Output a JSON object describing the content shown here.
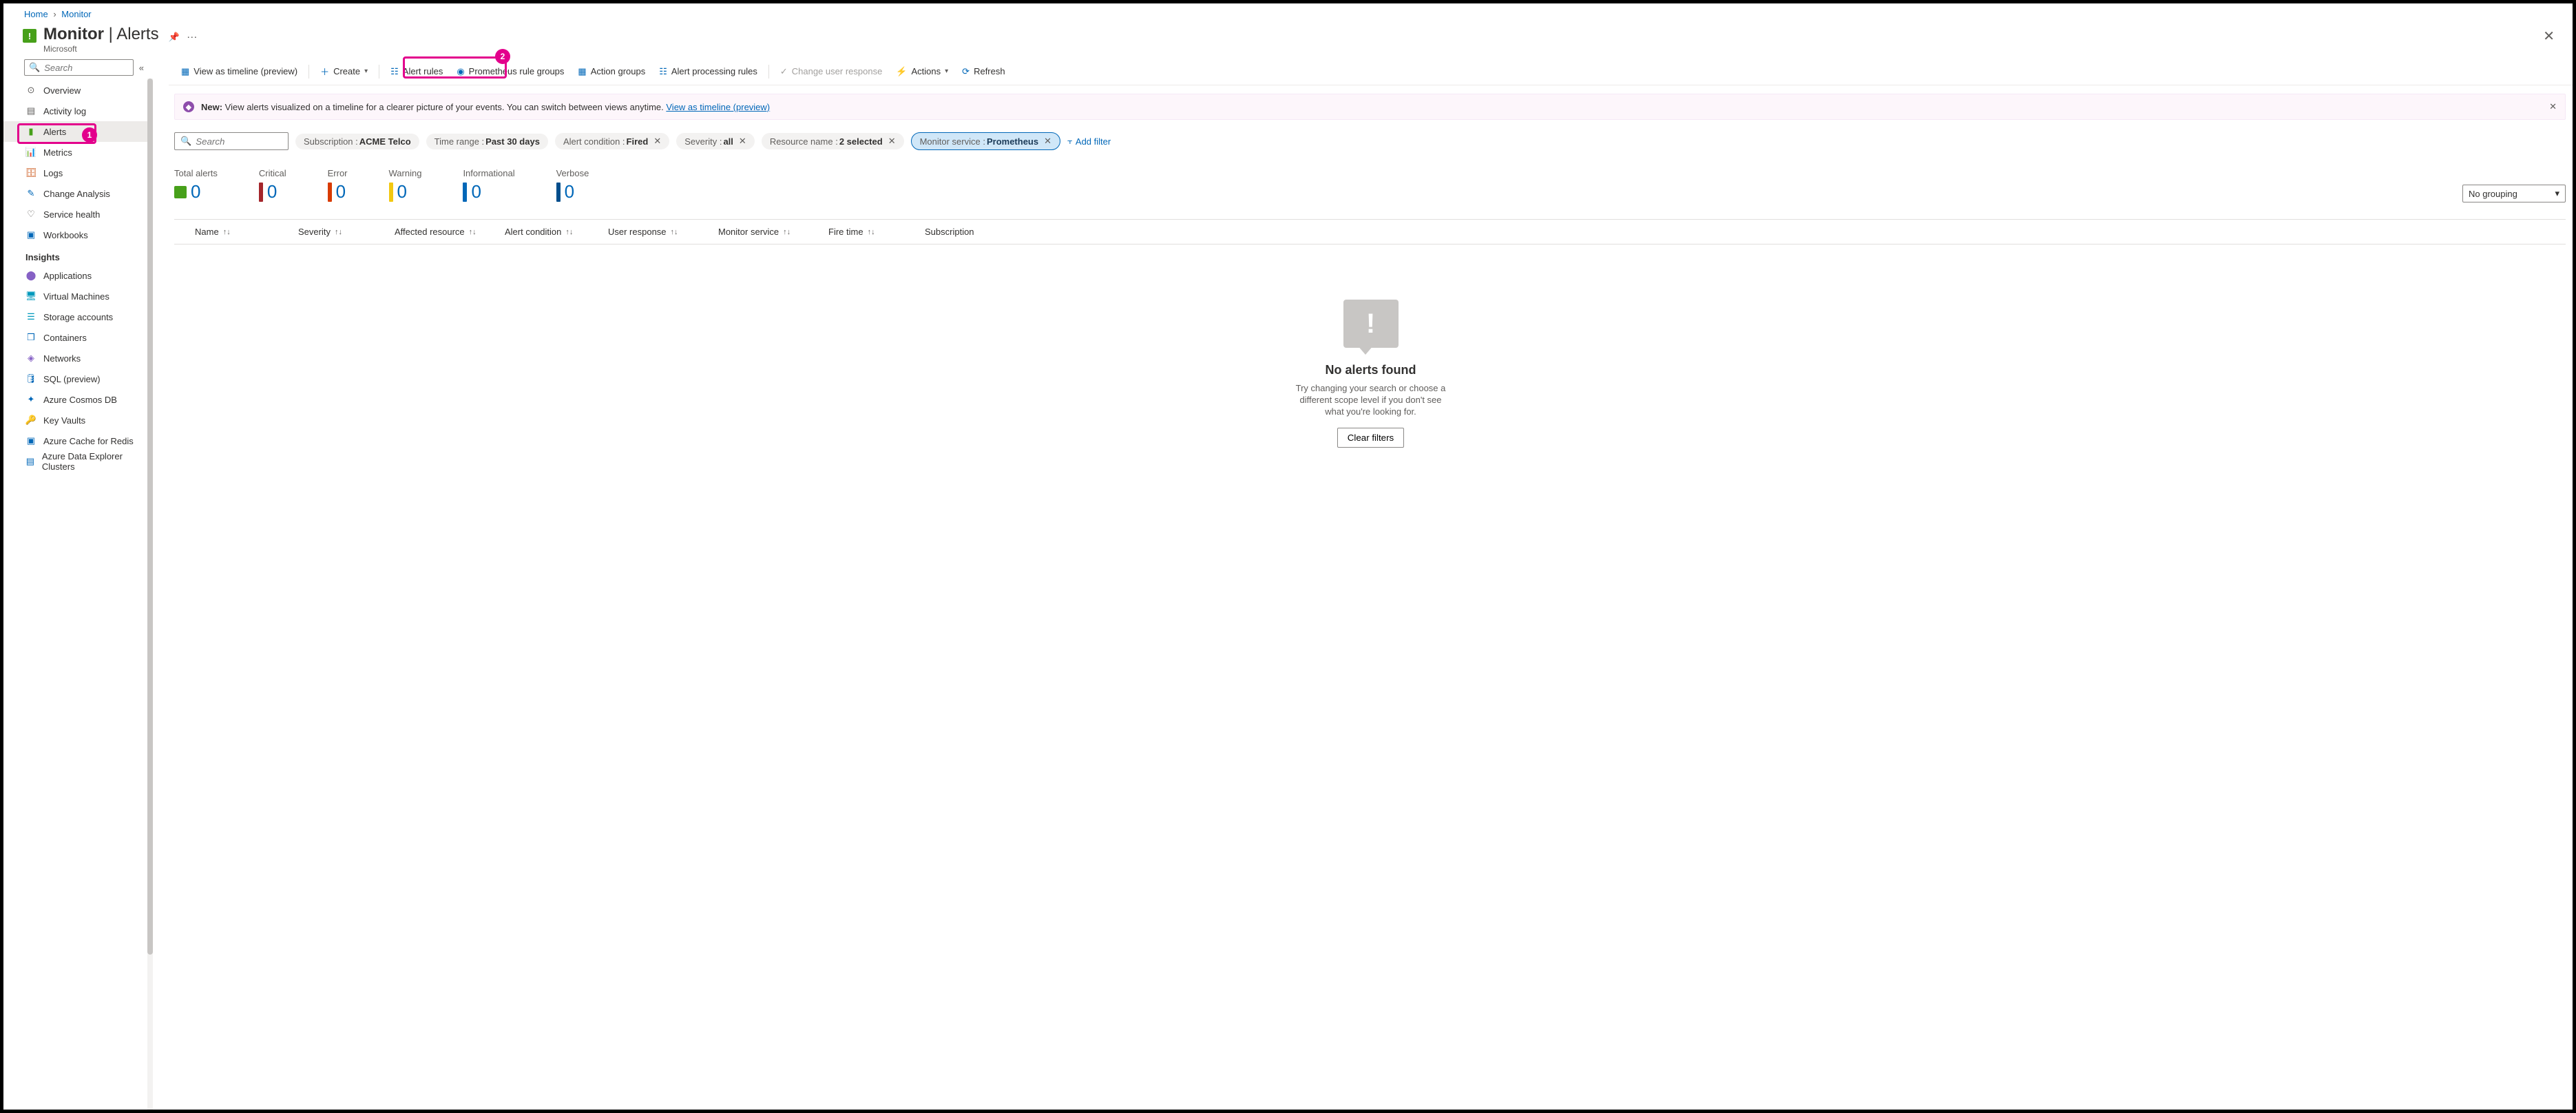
{
  "breadcrumb": {
    "home": "Home",
    "monitor": "Monitor"
  },
  "header": {
    "title_main": "Monitor",
    "title_sep": " | ",
    "title_sub": "Alerts",
    "provider": "Microsoft"
  },
  "sidebar": {
    "search_placeholder": "Search",
    "items": [
      {
        "label": "Overview"
      },
      {
        "label": "Activity log"
      },
      {
        "label": "Alerts",
        "active": true
      },
      {
        "label": "Metrics"
      },
      {
        "label": "Logs"
      },
      {
        "label": "Change Analysis"
      },
      {
        "label": "Service health"
      },
      {
        "label": "Workbooks"
      }
    ],
    "insights_label": "Insights",
    "insights": [
      {
        "label": "Applications"
      },
      {
        "label": "Virtual Machines"
      },
      {
        "label": "Storage accounts"
      },
      {
        "label": "Containers"
      },
      {
        "label": "Networks"
      },
      {
        "label": "SQL (preview)"
      },
      {
        "label": "Azure Cosmos DB"
      },
      {
        "label": "Key Vaults"
      },
      {
        "label": "Azure Cache for Redis"
      },
      {
        "label": "Azure Data Explorer Clusters"
      }
    ]
  },
  "toolbar": {
    "view_timeline": "View as timeline (preview)",
    "create": "Create",
    "alert_rules": "Alert rules",
    "prom_groups": "Prometheus rule groups",
    "action_groups": "Action groups",
    "processing_rules": "Alert processing rules",
    "change_user": "Change user response",
    "actions": "Actions",
    "refresh": "Refresh"
  },
  "info": {
    "lead": "New:",
    "text": " View alerts visualized on a timeline for a clearer picture of your events. You can switch between views anytime. ",
    "link": "View as timeline (preview)"
  },
  "filters": {
    "search_placeholder": "Search",
    "subscription": {
      "key": "Subscription : ",
      "val": "ACME Telco"
    },
    "timerange": {
      "key": "Time range : ",
      "val": "Past 30 days"
    },
    "condition": {
      "key": "Alert condition : ",
      "val": "Fired"
    },
    "severity": {
      "key": "Severity : ",
      "val": "all"
    },
    "resource": {
      "key": "Resource name : ",
      "val": "2 selected"
    },
    "monitor": {
      "key": "Monitor service : ",
      "val": "Prometheus"
    },
    "add": "Add filter"
  },
  "summary": {
    "total": {
      "label": "Total alerts",
      "value": "0"
    },
    "critical": {
      "label": "Critical",
      "value": "0",
      "color": "#A4262C"
    },
    "error": {
      "label": "Error",
      "value": "0",
      "color": "#D83B01"
    },
    "warning": {
      "label": "Warning",
      "value": "0",
      "color": "#F2C811"
    },
    "info": {
      "label": "Informational",
      "value": "0",
      "color": "#0067B8"
    },
    "verbose": {
      "label": "Verbose",
      "value": "0",
      "color": "#004E8C"
    },
    "grouping": "No grouping"
  },
  "columns": {
    "name": "Name",
    "severity": "Severity",
    "resource": "Affected resource",
    "condition": "Alert condition",
    "user": "User response",
    "monitor": "Monitor service",
    "fire": "Fire time",
    "subscription": "Subscription"
  },
  "empty": {
    "title": "No alerts found",
    "subtitle": "Try changing your search or choose a different scope level if you don't see what you're looking for.",
    "clear": "Clear filters"
  },
  "annotations": {
    "one": "1",
    "two": "2"
  }
}
